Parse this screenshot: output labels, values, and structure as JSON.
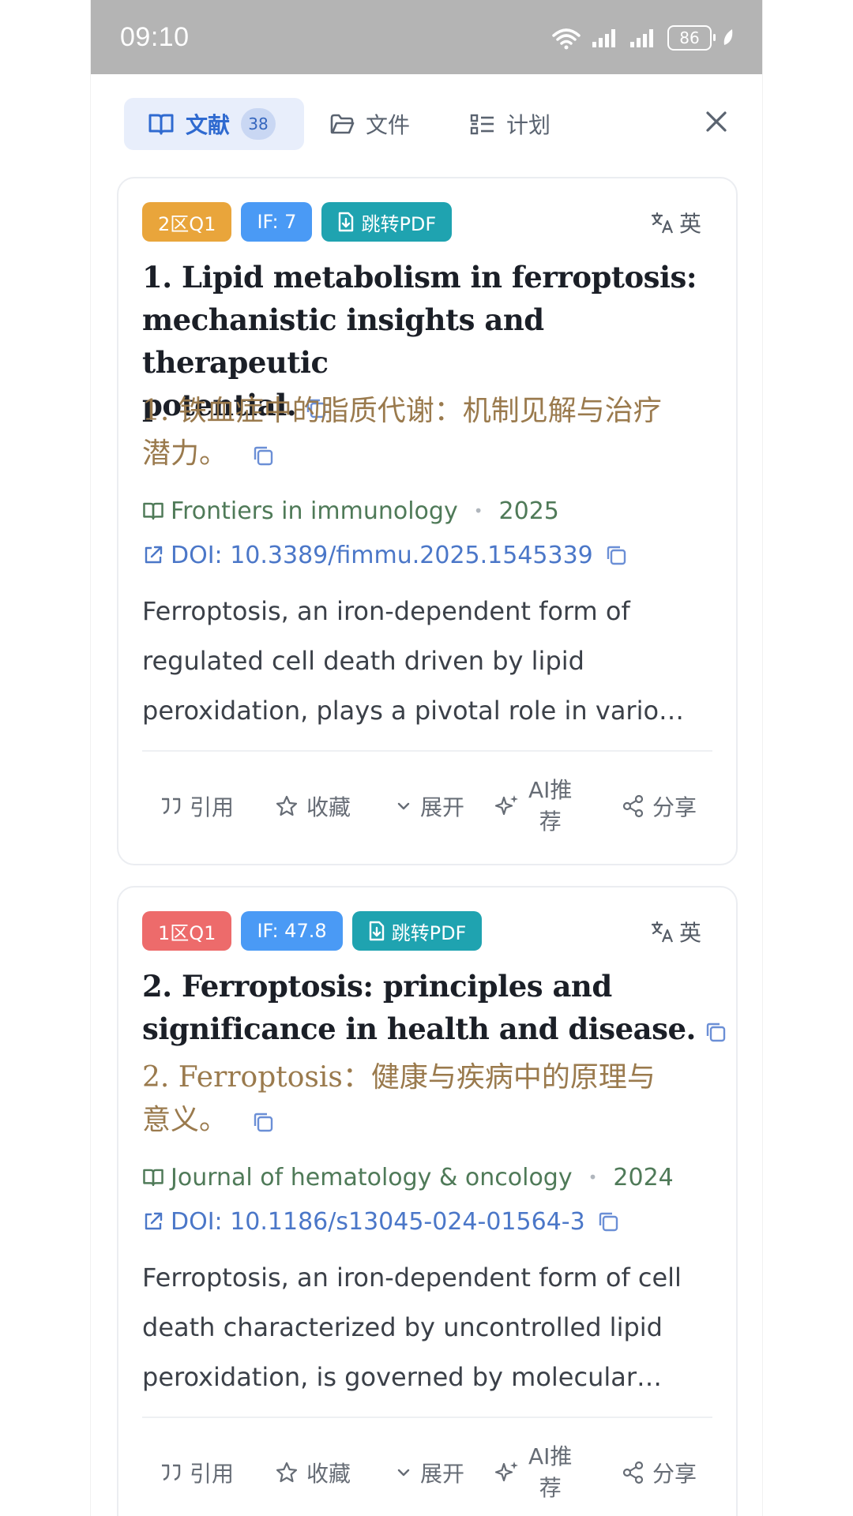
{
  "status_bar": {
    "time": "09:10",
    "battery": "86"
  },
  "tabs": [
    {
      "label": "文献",
      "count": "38",
      "icon": "book-icon",
      "active": true
    },
    {
      "label": "文件",
      "icon": "folder-icon",
      "active": false
    },
    {
      "label": "计划",
      "icon": "list-icon",
      "active": false
    }
  ],
  "colors": {
    "badge_zone_2": "#e9a53b",
    "badge_zone_1": "#ed6b6b",
    "badge_if": "#4a9af5",
    "badge_pdf": "#1fa3b0",
    "accent": "#2f6ad0"
  },
  "papers": [
    {
      "zone": "2区Q1",
      "impact_factor": "IF: 7",
      "pdf_label": "跳转PDF",
      "translate_label": "英",
      "title_en_lines": [
        "1. Lipid metabolism in ferroptosis:",
        "mechanistic insights and therapeutic",
        "potential."
      ],
      "title_zh_lines": [
        "1. 铁血症中的脂质代谢：机制见解与治疗",
        "潜力。"
      ],
      "journal": "Frontiers in immunology",
      "year": "2025",
      "doi": "DOI: 10.3389/fimmu.2025.1545339",
      "abstract_lines": [
        "Ferroptosis, an iron-dependent form of",
        "regulated cell death driven by lipid",
        "peroxidation, plays a pivotal role in vario…"
      ],
      "actions": {
        "cite": "引用",
        "favorite": "收藏",
        "expand": "展开",
        "ai_line1": "AI推",
        "ai_line2": "荐",
        "share": "分享"
      }
    },
    {
      "zone": "1区Q1",
      "impact_factor": "IF: 47.8",
      "pdf_label": "跳转PDF",
      "translate_label": "英",
      "title_en_lines": [
        "2. Ferroptosis: principles and",
        "significance in health and disease."
      ],
      "title_zh_lines": [
        "2. Ferroptosis：健康与疾病中的原理与",
        "意义。"
      ],
      "journal": "Journal of hematology & oncology",
      "year": "2024",
      "doi": "DOI: 10.1186/s13045-024-01564-3",
      "abstract_lines": [
        "Ferroptosis, an iron-dependent form of cell",
        "death characterized by uncontrolled lipid",
        "peroxidation, is governed by molecular…"
      ],
      "actions": {
        "cite": "引用",
        "favorite": "收藏",
        "expand": "展开",
        "ai_line1": "AI推",
        "ai_line2": "荐",
        "share": "分享"
      }
    }
  ]
}
